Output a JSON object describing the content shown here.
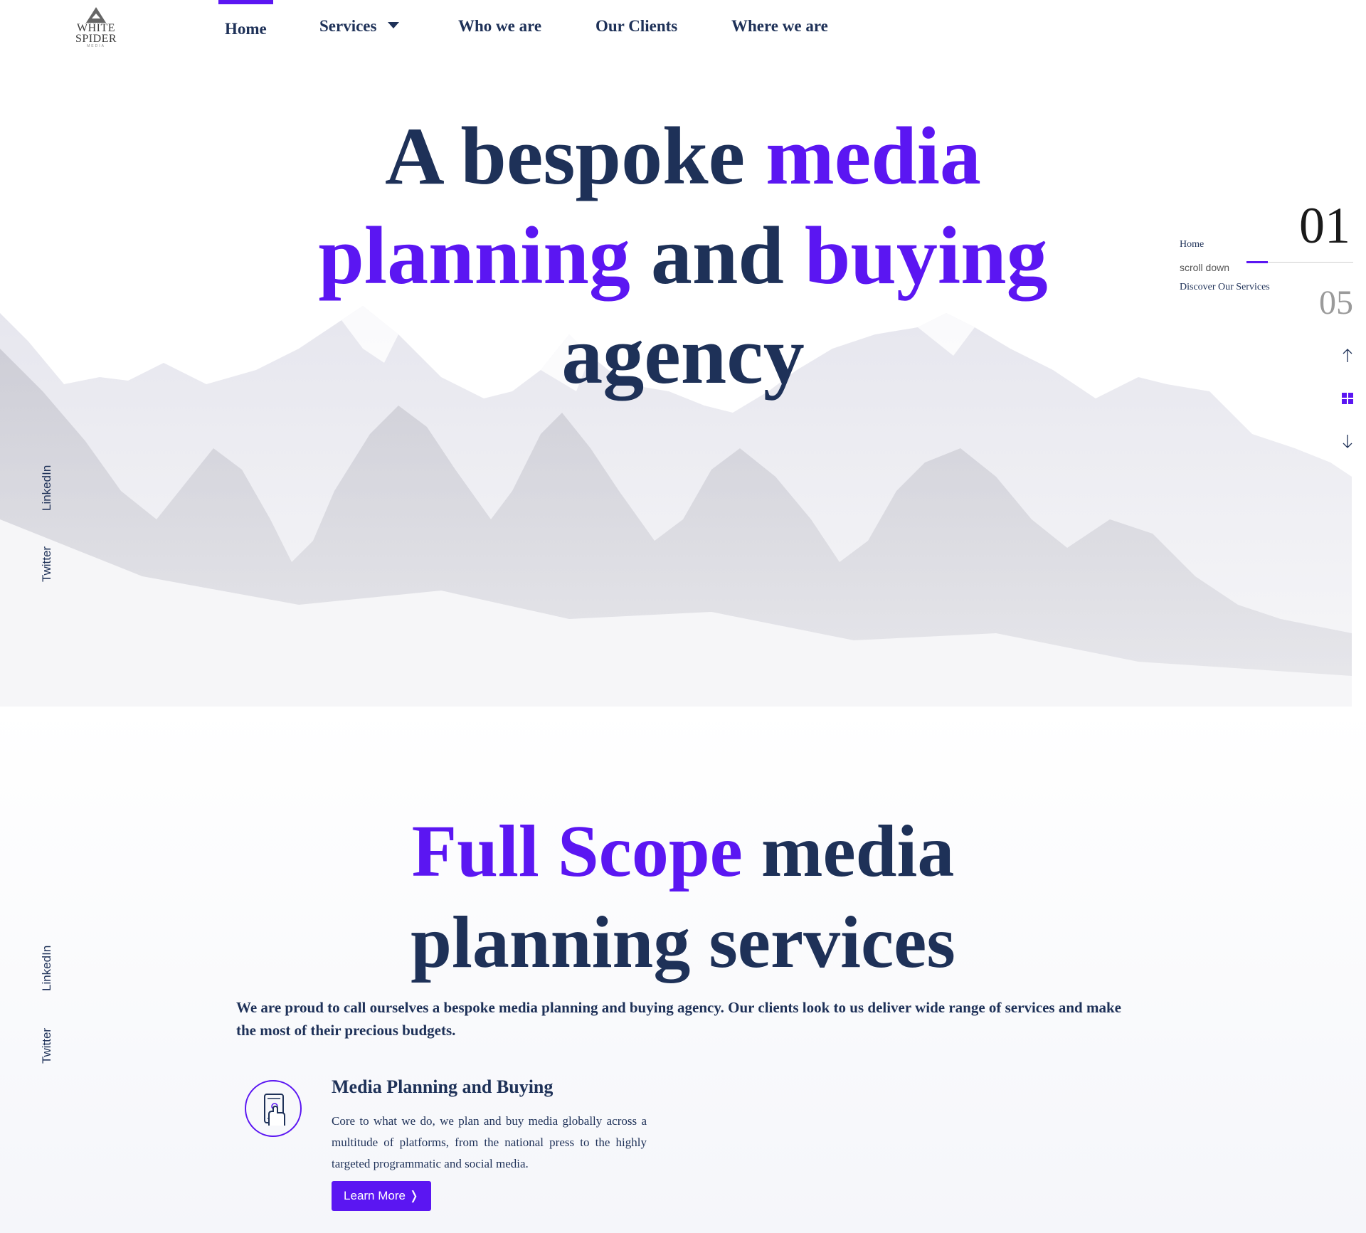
{
  "brand": {
    "logo_line1": "WHITE",
    "logo_line2": "SPIDER",
    "logo_sub": "MEDIA"
  },
  "nav": {
    "home": "Home",
    "services": "Services",
    "who_we_are": "Who we are",
    "our_clients": "Our Clients",
    "where_we_are": "Where we are"
  },
  "hero": {
    "title_part1": "A bespoke ",
    "title_accent1": "media planning",
    "title_part2": " and ",
    "title_accent2": "buying",
    "title_part3": " agency"
  },
  "social": {
    "linkedin": "LinkedIn",
    "twitter": "Twitter"
  },
  "slider": {
    "current": "01",
    "total": "05",
    "label_home": "Home",
    "label_scroll": "scroll down",
    "label_discover": "Discover Our Services",
    "progress": 0.2
  },
  "services": {
    "title_accent": "Full Scope",
    "title_rest": " media planning services",
    "intro": "We are proud to call ourselves a bespoke media planning and buying agency. Our clients look to us deliver wide range of services and make the most of their precious budgets.",
    "items": [
      {
        "title": "Media Planning and Buying",
        "description": "Core to what we do, we plan and buy media globally across a multitude of platforms, from the national press to the highly targeted programmatic and social media.",
        "button": "Learn More",
        "icon": "mobile-touch-icon"
      }
    ]
  },
  "colors": {
    "accent": "#5b16f2",
    "navy": "#1e3158"
  }
}
